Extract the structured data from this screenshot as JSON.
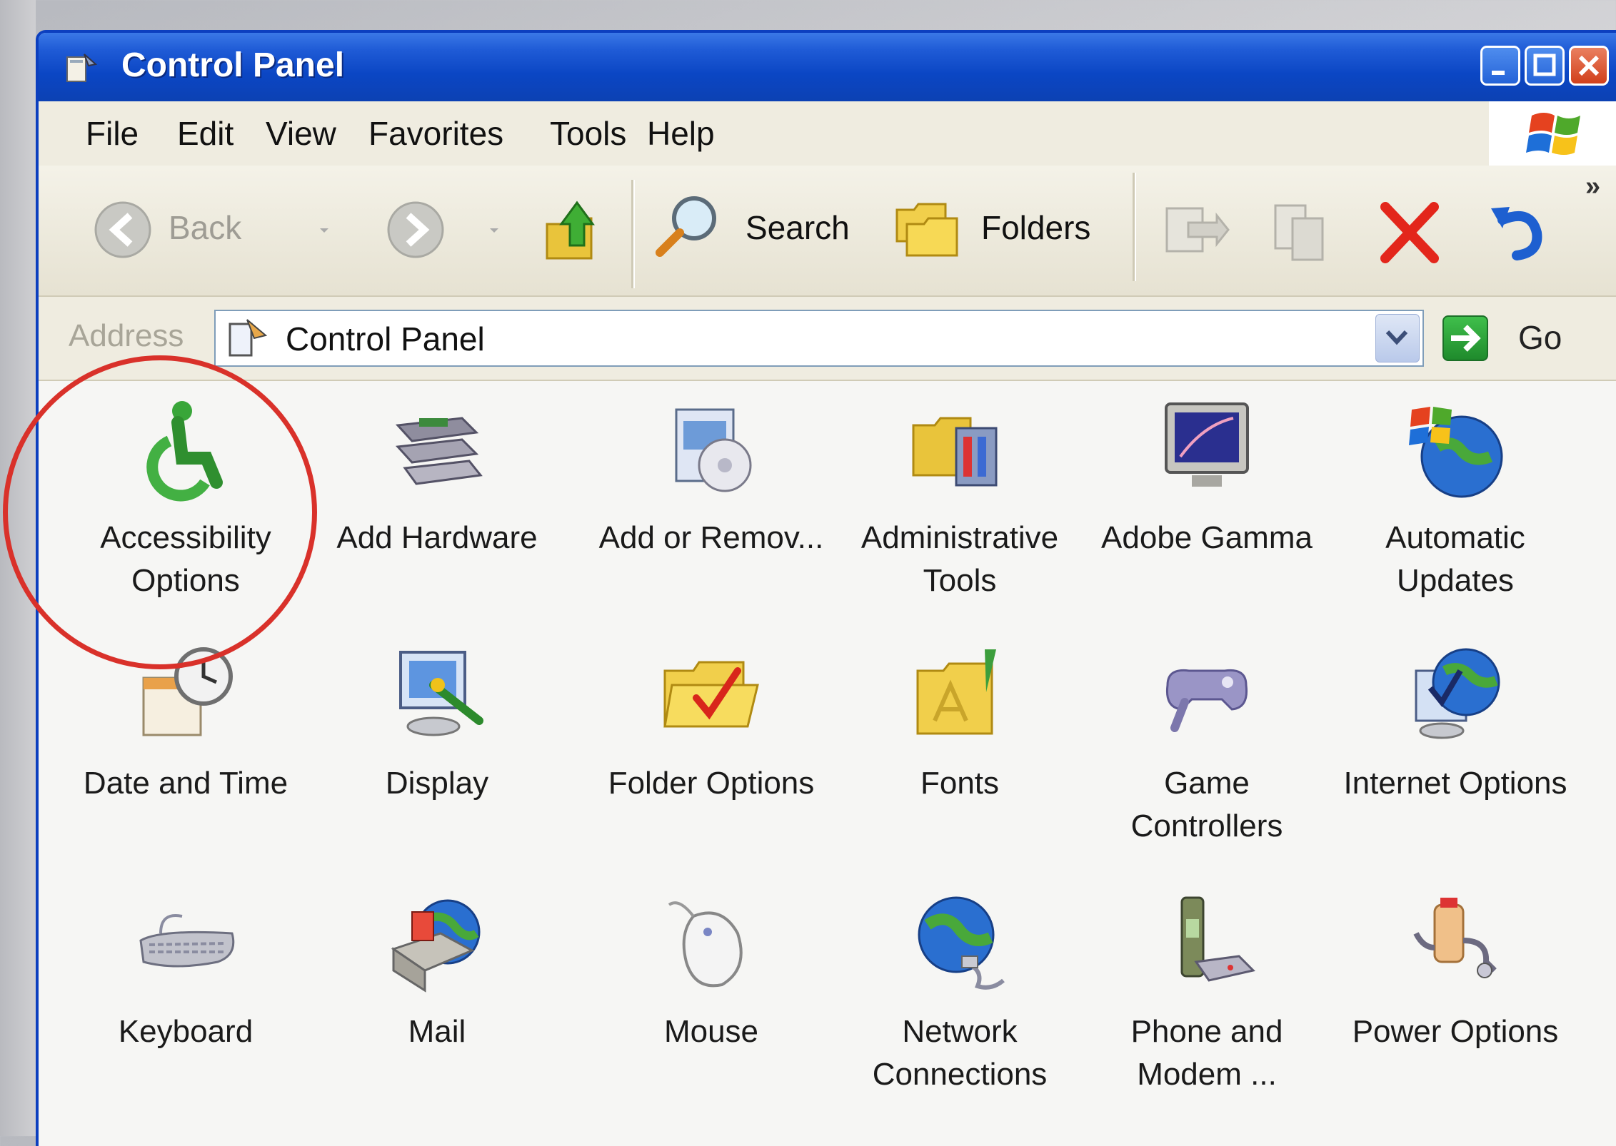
{
  "window": {
    "title": "Control Panel",
    "accent": "#0b46c4",
    "buttons": [
      "minimize-icon",
      "maximize-icon",
      "close-icon"
    ]
  },
  "menu": [
    "File",
    "Edit",
    "View",
    "Favorites",
    "Tools",
    "Help"
  ],
  "toolbar": {
    "back": "Back",
    "search": "Search",
    "folders": "Folders",
    "more": "»"
  },
  "address": {
    "label": "Address",
    "value": "Control Panel",
    "go": "Go"
  },
  "items": [
    {
      "label": "Accessibility Options",
      "icon": "wheelchair-icon",
      "highlighted": true
    },
    {
      "label": "Add Hardware",
      "icon": "hardware-icon"
    },
    {
      "label": "Add or Remov...",
      "icon": "add-remove-icon"
    },
    {
      "label": "Administrative Tools",
      "icon": "admin-tools-icon"
    },
    {
      "label": "Adobe Gamma",
      "icon": "monitor-icon"
    },
    {
      "label": "Automatic Updates",
      "icon": "globe-flag-icon"
    },
    {
      "label": "Date and Time",
      "icon": "clock-calendar-icon"
    },
    {
      "label": "Display",
      "icon": "display-icon"
    },
    {
      "label": "Folder Options",
      "icon": "folder-check-icon"
    },
    {
      "label": "Fonts",
      "icon": "fonts-folder-icon"
    },
    {
      "label": "Game Controllers",
      "icon": "gamepad-icon"
    },
    {
      "label": "Internet Options",
      "icon": "globe-check-icon"
    },
    {
      "label": "Keyboard",
      "icon": "keyboard-icon"
    },
    {
      "label": "Mail",
      "icon": "mail-icon"
    },
    {
      "label": "Mouse",
      "icon": "mouse-icon"
    },
    {
      "label": "Network Connections",
      "icon": "network-globe-icon"
    },
    {
      "label": "Phone and Modem ...",
      "icon": "phone-modem-icon"
    },
    {
      "label": "Power Options",
      "icon": "power-icon"
    }
  ],
  "highlight_color": "#d9312a"
}
